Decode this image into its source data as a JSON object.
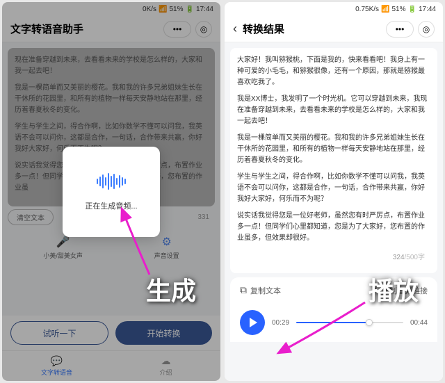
{
  "left": {
    "status": {
      "speed": "0K/s",
      "battery": "51%",
      "time": "17:44"
    },
    "header": {
      "title": "文字转语音助手"
    },
    "text": {
      "p1": "现在准备穿越到未来，去看看未来的学校是怎么样的，大家和我一起去吧！",
      "p2": "我是一棵简单而又美丽的樱花。我和我的许多兄弟姐妹生长在干休所的花园里，和所有的植物一样每天安静地站在那里，经历着春夏秋冬的变化。",
      "p3": "学生与学生之间，得合作啊，比如你数学不懂可以问我，我英语不会可以问你，这都是合作，一句话，合作带来共赢，你好我好大家好，何乐而不为呢？",
      "p4": "说实话我觉得您是一位好老师，虽然您有时严厉点，布置作业多一点！但同学们心里都知道，您是为了大家好，您布置的作业虽",
      "count": "331"
    },
    "clear_btn": "清空文本",
    "voice": {
      "opt1": "小美/甜美女声",
      "opt2": "声音设置"
    },
    "btns": {
      "preview": "试听一下",
      "start": "开始转换"
    },
    "nav": {
      "tab1": "文字转语音",
      "tab2": "介绍"
    },
    "modal": {
      "text": "正在生成音频..."
    },
    "annotation": "生成"
  },
  "right": {
    "status": {
      "speed": "0.75K/s",
      "battery": "51%",
      "time": "17:44"
    },
    "header": {
      "title": "转换结果"
    },
    "text": {
      "p1": "大家好！我叫猕猴桃，下面是我的，快来看看吧！我身上有一种可爱的小毛毛，和猕猴很像，还有一个原因，那就是猕猴最喜欢吃我了。",
      "p2": "我是XX博士，我发明了一个时光机。它可以穿越到未来，我现在准备穿越到未来，去看看未来的学校是怎么样的，大家和我一起去吧！",
      "p3": "我是一棵简单而又美丽的樱花。我和我的许多兄弟姐妹生长在干休所的花园里，和所有的植物一样每天安静地站在那里，经历着春夏秋冬的变化。",
      "p4": "学生与学生之间，得合作啊，比如你数学不懂可以问我，我英语不会可以问你，这都是合作，一句话，合作带来共赢，你好我好大家好，何乐而不为呢？",
      "p5": "说实话我觉得您是一位好老师，虽然您有时严厉点，布置作业多一点！但同学们心里都知道，您是为了大家好，您布置的作业虽多，但效果却很好。",
      "count": "324",
      "max": "/500字"
    },
    "actions": {
      "copy_text": "复制文本",
      "copy_link": "复制音频链接"
    },
    "player": {
      "current": "00:29",
      "total": "00:44"
    },
    "annotation": "播放"
  }
}
